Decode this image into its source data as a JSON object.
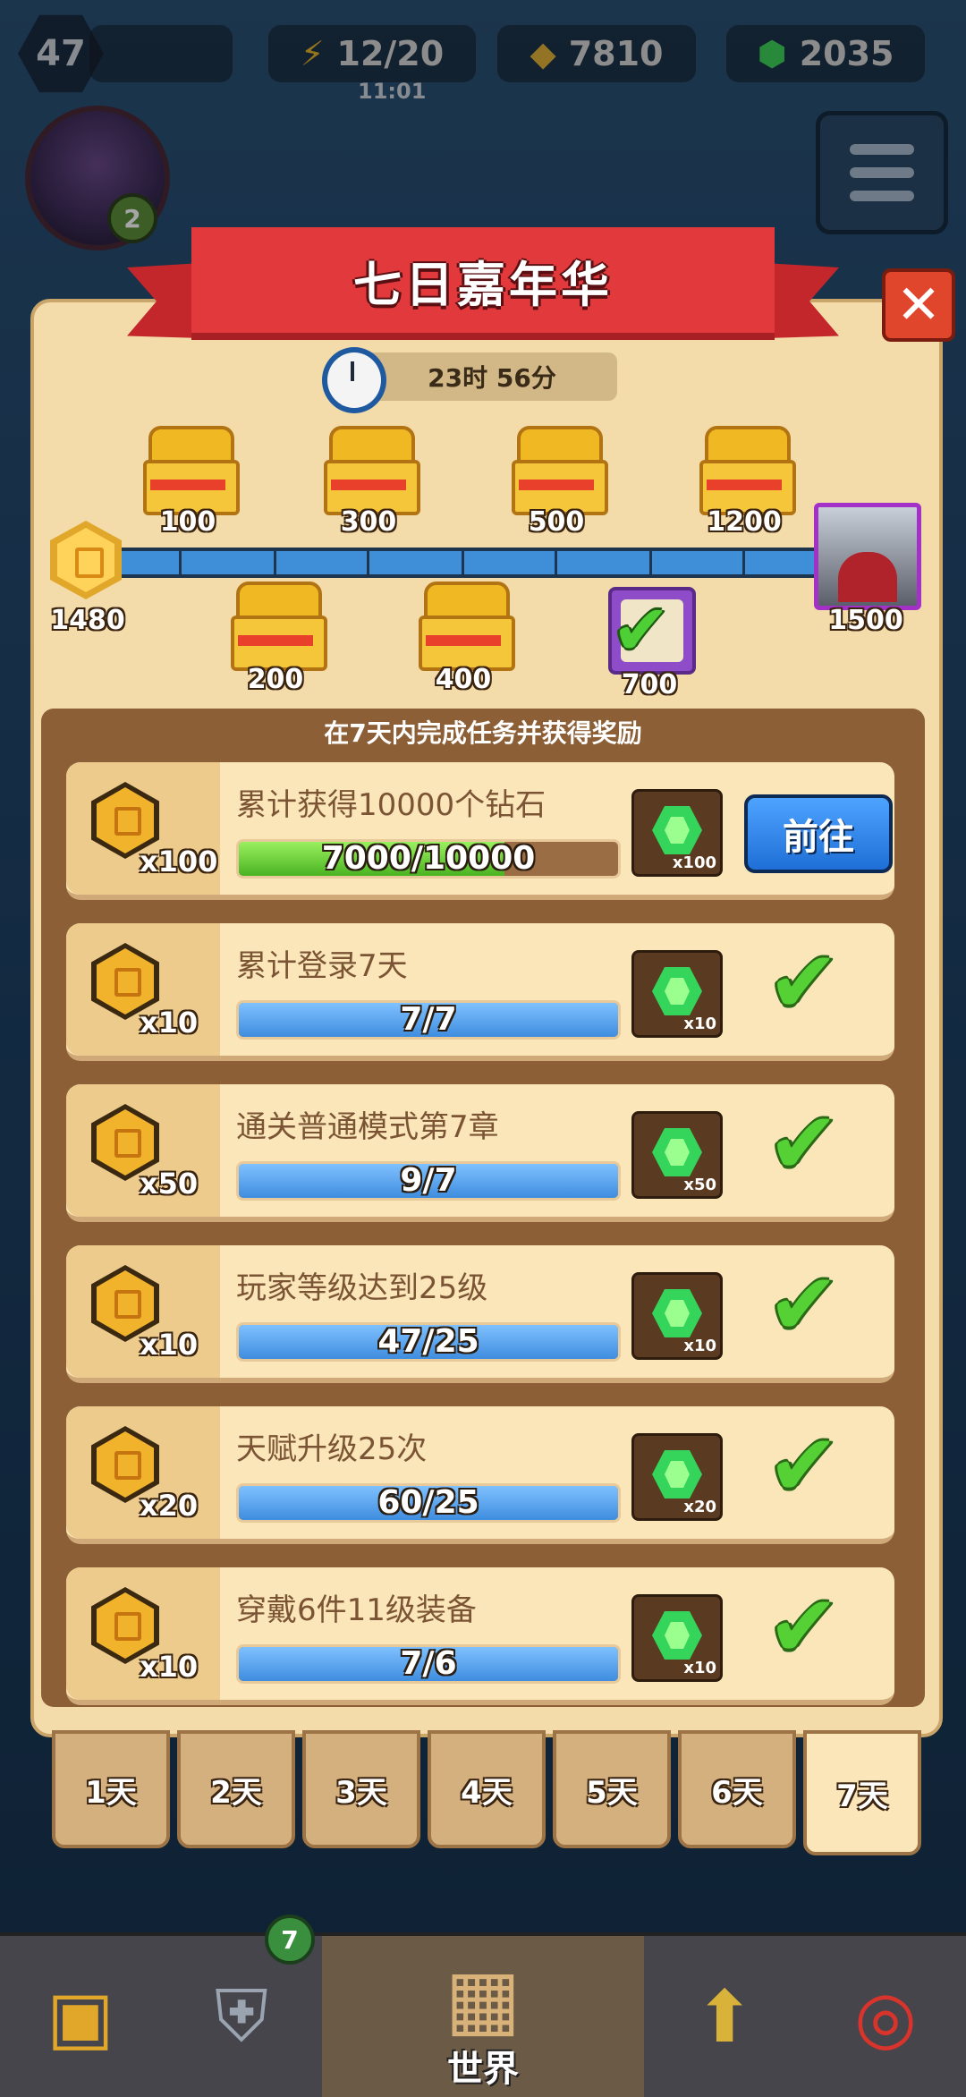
{
  "hud": {
    "player_level": "47",
    "energy": "12/20",
    "energy_timer": "11:01",
    "coins": "7810",
    "gems": "2035",
    "avatar_badge": "2"
  },
  "event": {
    "title": "七日嘉年华",
    "timer": "23时 56分",
    "milestones_top": [
      "100",
      "300",
      "500",
      "1200"
    ],
    "milestones_bottom": [
      "200",
      "400",
      "700"
    ],
    "points_current": "1480",
    "points_final": "1500",
    "list_header": "在7天内完成任务并获得奖励"
  },
  "tasks": [
    {
      "points": "x100",
      "title": "累计获得10000个钻石",
      "progress": "7000/10000",
      "fill": 0.7,
      "reward_count": "x100",
      "action": "前往",
      "status": "in-progress"
    },
    {
      "points": "x10",
      "title": "累计登录7天",
      "progress": "7/7",
      "fill": 1.0,
      "reward_count": "x10",
      "status": "done"
    },
    {
      "points": "x50",
      "title": "通关普通模式第7章",
      "progress": "9/7",
      "fill": 1.0,
      "reward_count": "x50",
      "status": "done"
    },
    {
      "points": "x10",
      "title": "玩家等级达到25级",
      "progress": "47/25",
      "fill": 1.0,
      "reward_count": "x10",
      "status": "done"
    },
    {
      "points": "x20",
      "title": "天赋升级25次",
      "progress": "60/25",
      "fill": 1.0,
      "reward_count": "x20",
      "status": "done"
    },
    {
      "points": "x10",
      "title": "穿戴6件11级装备",
      "progress": "7/6",
      "fill": 1.0,
      "reward_count": "x10",
      "status": "done"
    }
  ],
  "day_tabs": [
    "1天",
    "2天",
    "3天",
    "4天",
    "5天",
    "6天",
    "7天"
  ],
  "active_day": "7天",
  "nav": {
    "world_label": "世界",
    "equipment_badge": "7"
  },
  "colors": {
    "ribbon": "#e23a3c",
    "panel": "#f3dcaa",
    "progress_blue": "#3f8ddf",
    "progress_green": "#4ab321",
    "go_button": "#1f6fd6"
  }
}
